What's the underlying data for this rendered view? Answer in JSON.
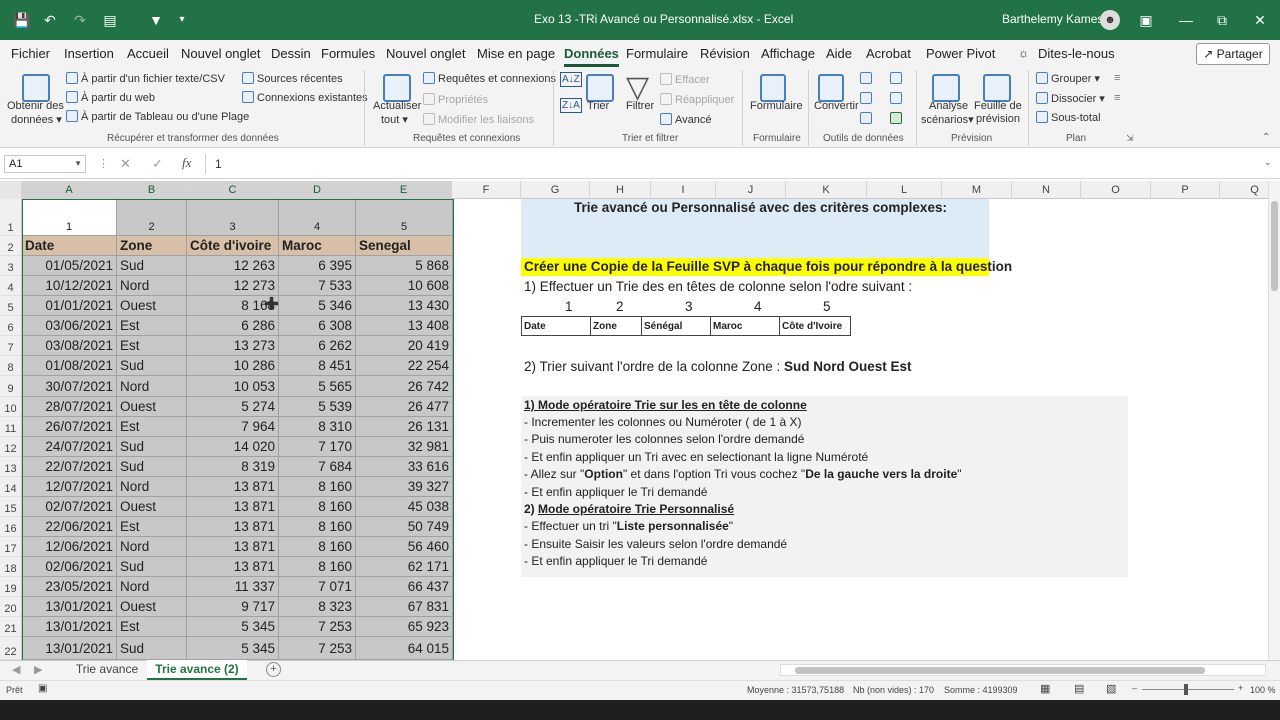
{
  "titlebar": {
    "filename": "Exo 13 -TRi Avancé ou Personnalisé.xlsx  -  Excel",
    "user": "Barthelemy Kamess"
  },
  "menu": [
    "Fichier",
    "Insertion",
    "Accueil",
    "Nouvel onglet",
    "Dessin",
    "Formules",
    "Nouvel onglet",
    "Mise en page",
    "Données",
    "Formulaire",
    "Révision",
    "Affichage",
    "Aide",
    "Acrobat",
    "Power Pivot",
    "Dites-le-nous"
  ],
  "share": "Partager",
  "ribbon": {
    "obtenir": "Obtenir des",
    "donnees": "données",
    "fichier_texte": "À partir d'un fichier texte/CSV",
    "web": "À partir du web",
    "tableau": "À partir de Tableau ou d'une Plage",
    "sources": "Sources récentes",
    "connexions_existantes": "Connexions existantes",
    "grp_recuperer": "Récupérer et transformer des données",
    "actualiser": "Actualiser",
    "tout": "tout",
    "req_connexions": "Requêtes et connexions",
    "proprietes": "Propriétés",
    "modifier_liaisons": "Modifier les liaisons",
    "grp_requetes": "Requêtes et connexions",
    "trier": "Trier",
    "filtrer": "Filtrer",
    "effacer": "Effacer",
    "reappliquer": "Réappliquer",
    "avance": "Avancé",
    "grp_trier": "Trier et filtrer",
    "formulaire": "Formulaire",
    "grp_formulaire": "Formulaire",
    "convertir": "Convertir",
    "grp_outils": "Outils de données",
    "analyse": "Analyse",
    "scenarios": "scénarios",
    "feuille": "Feuille de",
    "prevision": "prévision",
    "grp_prevision": "Prévision",
    "grouper": "Grouper",
    "dissocier": "Dissocier",
    "sous_total": "Sous-total",
    "grp_plan": "Plan"
  },
  "formula": {
    "namebox": "A1",
    "value": "1"
  },
  "columns": [
    "A",
    "B",
    "C",
    "D",
    "E",
    "F",
    "G",
    "H",
    "I",
    "J",
    "K",
    "L",
    "M",
    "N",
    "O",
    "P",
    "Q"
  ],
  "rows": [
    "1",
    "2",
    "3",
    "4",
    "5",
    "6",
    "7",
    "8",
    "9",
    "10",
    "11",
    "12",
    "13",
    "14",
    "15",
    "16",
    "17",
    "18",
    "19",
    "20",
    "21",
    "22"
  ],
  "table": {
    "numbers": [
      "1",
      "2",
      "3",
      "4",
      "5"
    ],
    "headers": [
      "Date",
      "Zone",
      "Côte d'ivoire",
      "Maroc",
      "Senegal"
    ],
    "data": [
      [
        "01/05/2021",
        "Sud",
        "12 263",
        "6 395",
        "5 868"
      ],
      [
        "10/12/2021",
        "Nord",
        "12 273",
        "7 533",
        "10 608"
      ],
      [
        "01/01/2021",
        "Ouest",
        "8 168",
        "5 346",
        "13 430"
      ],
      [
        "03/06/2021",
        "Est",
        "6 286",
        "6 308",
        "13 408"
      ],
      [
        "03/08/2021",
        "Est",
        "13 273",
        "6 262",
        "20 419"
      ],
      [
        "01/08/2021",
        "Sud",
        "10 286",
        "8 451",
        "22 254"
      ],
      [
        "30/07/2021",
        "Nord",
        "10 053",
        "5 565",
        "26 742"
      ],
      [
        "28/07/2021",
        "Ouest",
        "5 274",
        "5 539",
        "26 477"
      ],
      [
        "26/07/2021",
        "Est",
        "7 964",
        "8 310",
        "26 131"
      ],
      [
        "24/07/2021",
        "Sud",
        "14 020",
        "7 170",
        "32 981"
      ],
      [
        "22/07/2021",
        "Sud",
        "8 319",
        "7 684",
        "33 616"
      ],
      [
        "12/07/2021",
        "Nord",
        "13 871",
        "8 160",
        "39 327"
      ],
      [
        "02/07/2021",
        "Ouest",
        "13 871",
        "8 160",
        "45 038"
      ],
      [
        "22/06/2021",
        "Est",
        "13 871",
        "8 160",
        "50 749"
      ],
      [
        "12/06/2021",
        "Nord",
        "13 871",
        "8 160",
        "56 460"
      ],
      [
        "02/06/2021",
        "Sud",
        "13 871",
        "8 160",
        "62 171"
      ],
      [
        "23/05/2021",
        "Nord",
        "11 337",
        "7 071",
        "66 437"
      ],
      [
        "13/01/2021",
        "Ouest",
        "9 717",
        "8 323",
        "67 831"
      ],
      [
        "13/01/2021",
        "Est",
        "5 345",
        "7 253",
        "65 923"
      ],
      [
        "13/01/2021",
        "Sud",
        "5 345",
        "7 253",
        "64 015"
      ]
    ]
  },
  "notes": {
    "title": "Trie avancé ou Personnalisé avec des critères complexes:",
    "copy": "Créer une Copie de la Feuille SVP à chaque fois pour répondre à la question",
    "q1": "1) Effectuer un Trie des en têtes de colonne selon l'odre suivant :",
    "order_nums": [
      "1",
      "2",
      "3",
      "4",
      "5"
    ],
    "order_labels": [
      "Date",
      "Zone",
      "Sénégal",
      "Maroc",
      "Côte d'Ivoire"
    ],
    "q2": "2) Trier suivant l'ordre  de la colonne Zone :",
    "q2_order": "Sud  Nord  Ouest  Est",
    "m1_title": "1) Mode opératoire Trie sur les en tête de colonne",
    "m1_l1": " - Incrementer les colonnes ou Numéroter ( de 1 à X)",
    "m1_l2": "- Puis numeroter les colonnes selon l'ordre demandé",
    "m1_l3": "- Et enfin appliquer un Tri avec en selectionant la ligne Numéroté",
    "m1_l4a": "- Allez sur \"",
    "m1_l4b": "Option",
    "m1_l4c": "\" et dans l'option Tri vous cochez \"",
    "m1_l4d": "De la gauche vers la droite",
    "m1_l4e": "\"",
    "m1_l5": "- Et enfin appliquer le Tri demandé",
    "m2_title_num": "2) ",
    "m2_title": "Mode opératoire Trie Personnalisé",
    "m2_l1a": " - Effectuer un tri \"",
    "m2_l1b": "Liste personnalisée",
    "m2_l1c": "\"",
    "m2_l2": "- Ensuite Saisir les valeurs selon l'ordre demandé",
    "m2_l3": "- Et enfin appliquer le Tri demandé"
  },
  "sheets": [
    "Trie avance",
    "Trie avance  (2)"
  ],
  "status": {
    "ready": "Prêt",
    "average": "Moyenne : 31573,75188",
    "count": "Nb (non vides) : 170",
    "sum": "Somme : 4199309",
    "zoom": "100 %"
  },
  "colors": {
    "excel_green": "#217346",
    "header_fill": "#d7bfa8",
    "highlight": "#ffff00",
    "title_fill": "#ddebf7"
  }
}
